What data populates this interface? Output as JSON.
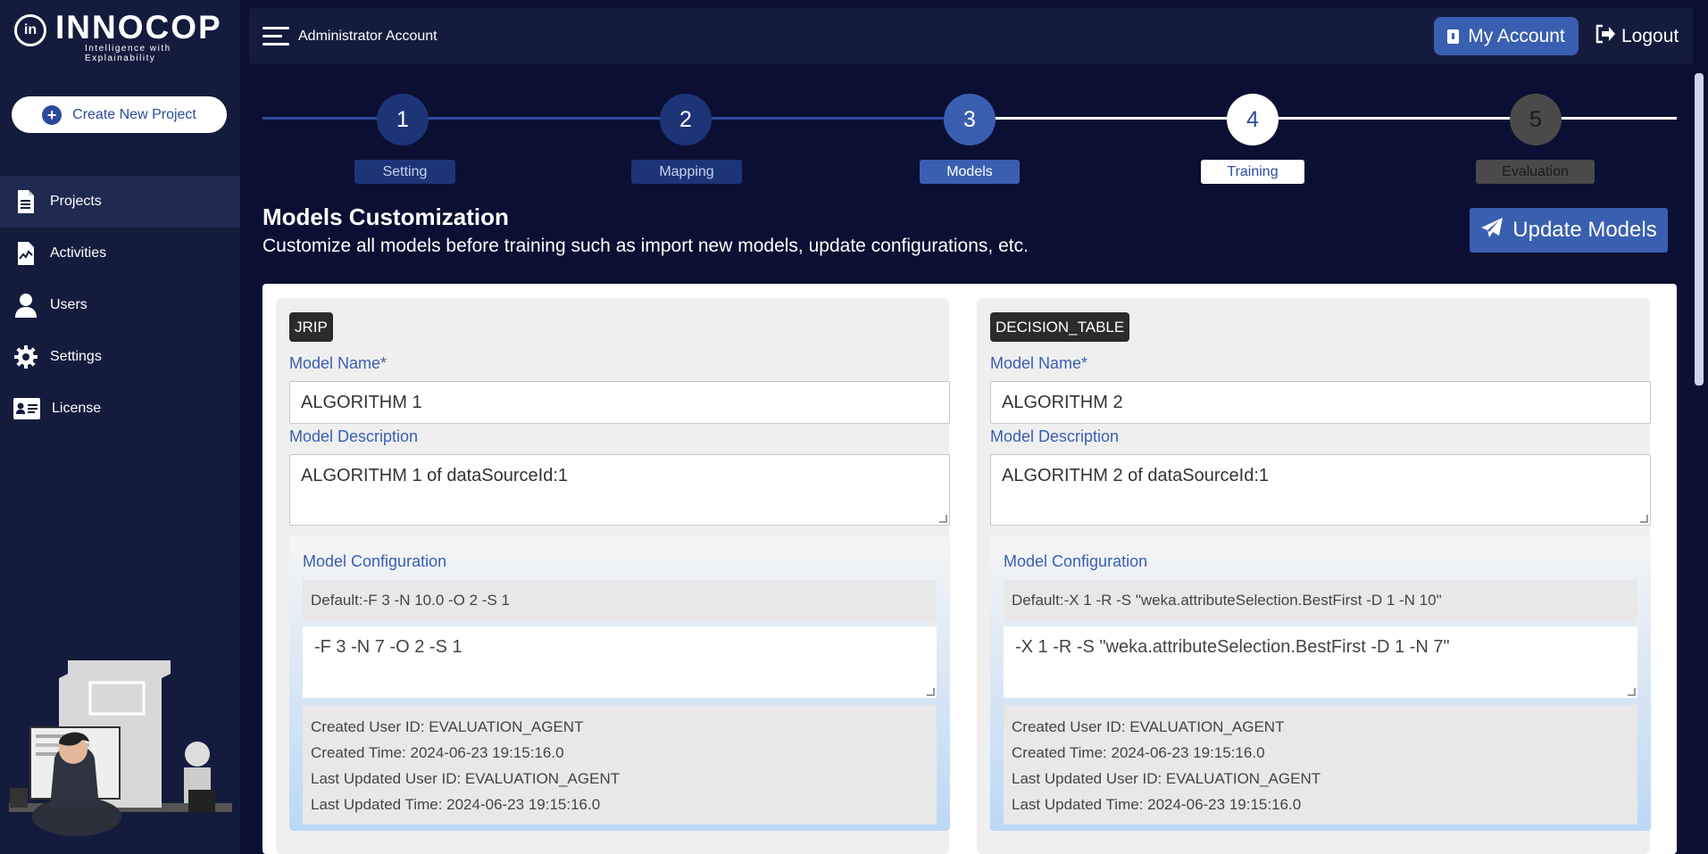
{
  "brand": {
    "name": "INNOCOP",
    "tagline": "Intelligence with Explainability",
    "mark": "in"
  },
  "sidebar": {
    "create_label": "Create New Project",
    "items": [
      {
        "label": "Projects",
        "icon": "document-icon",
        "active": true
      },
      {
        "label": "Activities",
        "icon": "activity-icon",
        "active": false
      },
      {
        "label": "Users",
        "icon": "user-icon",
        "active": false
      },
      {
        "label": "Settings",
        "icon": "gear-icon",
        "active": false
      },
      {
        "label": "License",
        "icon": "id-card-icon",
        "active": false
      }
    ]
  },
  "topbar": {
    "account_name": "Administrator Account",
    "my_account": "My Account",
    "logout": "Logout"
  },
  "stepper": {
    "steps": [
      {
        "number": "1",
        "label": "Setting",
        "state": "done"
      },
      {
        "number": "2",
        "label": "Mapping",
        "state": "done"
      },
      {
        "number": "3",
        "label": "Models",
        "state": "current"
      },
      {
        "number": "4",
        "label": "Training",
        "state": "next"
      },
      {
        "number": "5",
        "label": "Evaluation",
        "state": "disabled"
      }
    ]
  },
  "header": {
    "title": "Models Customization",
    "subtitle": "Customize all models before training such as import new models, update configurations, etc.",
    "update_button": "Update Models"
  },
  "labels": {
    "model_name": "Model Name*",
    "model_description": "Model Description",
    "model_configuration": "Model Configuration"
  },
  "models": [
    {
      "type": "JRIP",
      "name": "ALGORITHM 1",
      "description": "ALGORITHM 1 of dataSourceId:1",
      "default": "Default:-F 3 -N 10.0 -O 2 -S 1",
      "config": "-F 3 -N 7 -O 2 -S 1",
      "created_user": "Created User ID: EVALUATION_AGENT",
      "created_time": "Created Time: 2024-06-23 19:15:16.0",
      "updated_user": "Last Updated User ID: EVALUATION_AGENT",
      "updated_time": "Last Updated Time: 2024-06-23 19:15:16.0"
    },
    {
      "type": "DECISION_TABLE",
      "name": "ALGORITHM 2",
      "description": "ALGORITHM 2 of dataSourceId:1",
      "default": "Default:-X 1 -R -S \"weka.attributeSelection.BestFirst -D 1 -N 10\"",
      "config": "-X 1 -R -S \"weka.attributeSelection.BestFirst -D 1 -N 7\"",
      "created_user": "Created User ID: EVALUATION_AGENT",
      "created_time": "Created Time: 2024-06-23 19:15:16.0",
      "updated_user": "Last Updated User ID: EVALUATION_AGENT",
      "updated_time": "Last Updated Time: 2024-06-23 19:15:16.0"
    }
  ],
  "colors": {
    "accent": "#3a5fb0",
    "sidebar": "#141c3d",
    "background": "#0b0f33",
    "step_done": "#1d3576",
    "step_disabled": "#4a4a4a"
  }
}
